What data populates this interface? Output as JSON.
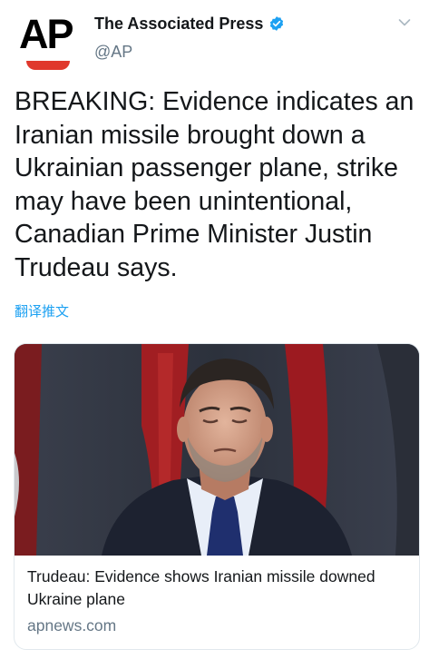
{
  "account": {
    "avatar_text": "AP",
    "name": "The Associated Press",
    "handle": "@AP"
  },
  "tweet": {
    "text": "BREAKING: Evidence indicates an Iranian missile brought down a Ukrainian passenger plane, strike may have been unintentional, Canadian Prime Minister Justin Trudeau says.",
    "translate_label": "翻译推文"
  },
  "card": {
    "title": "Trudeau: Evidence shows Iranian missile downed Ukraine plane",
    "domain": "apnews.com"
  },
  "colors": {
    "link": "#1da1f2",
    "verified": "#1da1f2",
    "brand_red": "#e0382c",
    "muted": "#657786"
  }
}
